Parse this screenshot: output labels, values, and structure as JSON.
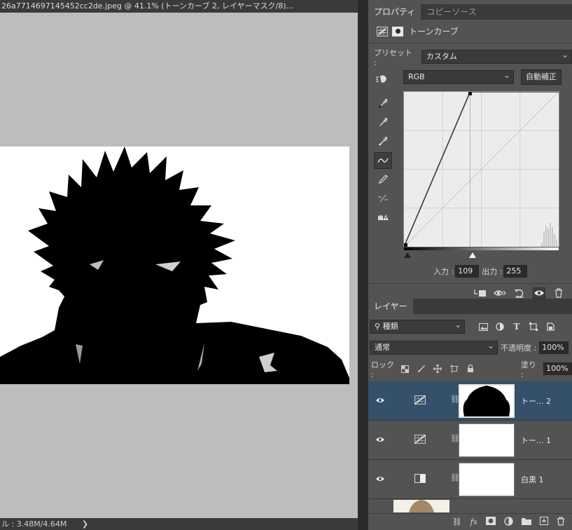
{
  "document": {
    "tab_title": "26a7714697145452cc2de.jpeg @ 41.1% (トーンカーブ 2, レイヤーマスク/8)...",
    "status": "ル : 3.48M/4.64M",
    "status_arrow": "❯"
  },
  "properties": {
    "tabs": [
      "プロパティ",
      "コピーソース"
    ],
    "panel_title": "トーンカーブ",
    "preset_label": "プリセット :",
    "preset_value": "カスタム",
    "channel_value": "RGB",
    "auto_button": "自動補正",
    "input_label": "入力 :",
    "input_value": "109",
    "output_label": "出力 :",
    "output_value": "255",
    "curve": {
      "point_black": [
        0,
        0
      ],
      "point_white": [
        109,
        255
      ],
      "line_color": "#3a3a3a",
      "grid": true
    }
  },
  "layers": {
    "tab": "レイヤー",
    "filter_value": "種類",
    "blend_mode": "通常",
    "opacity_label": "不透明度 :",
    "opacity_value": "100%",
    "lock_label": "ロック :",
    "fill_label": "塗り :",
    "fill_value": "100%",
    "items": [
      {
        "name": "トー... 2",
        "type": "curves",
        "selected": true
      },
      {
        "name": "トー... 1",
        "type": "curves",
        "selected": false
      },
      {
        "name": "白黒 1",
        "type": "black-white",
        "selected": false
      }
    ],
    "accent_color": "#34506a"
  }
}
